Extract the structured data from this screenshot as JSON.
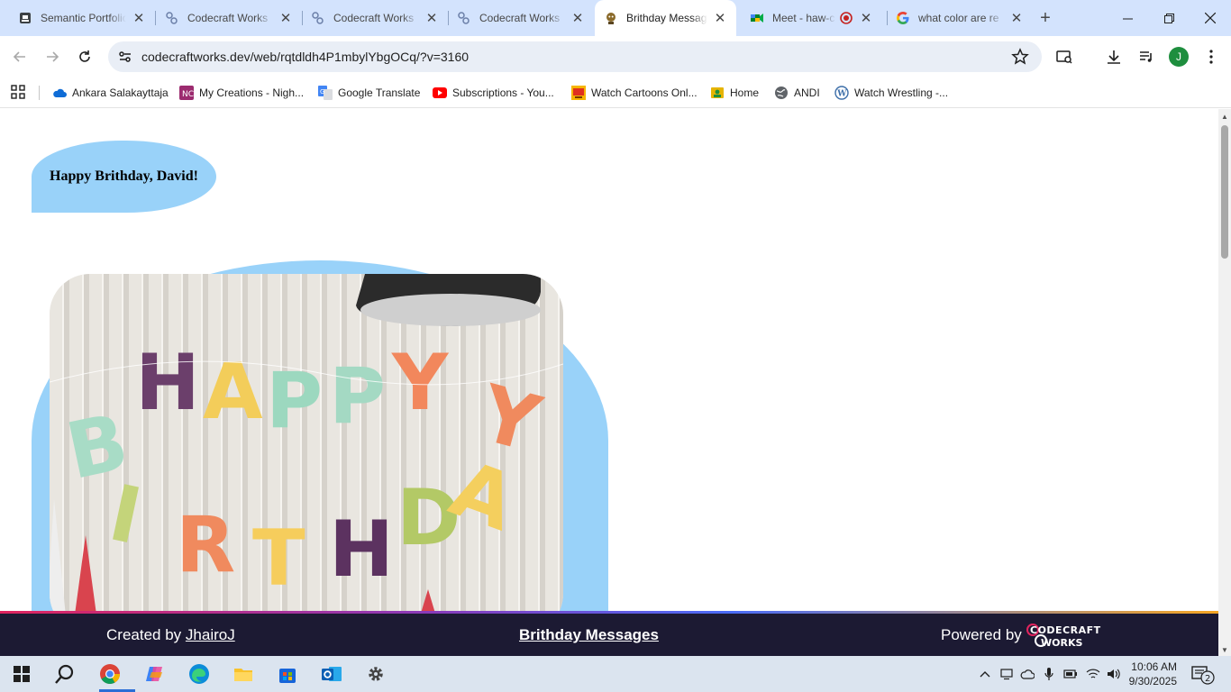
{
  "browser": {
    "tabs": [
      {
        "title": "Semantic Portfolio",
        "icon": "portfolio-icon",
        "active": false
      },
      {
        "title": "Codecraft Works",
        "icon": "codecraft-icon",
        "active": false
      },
      {
        "title": "Codecraft Works",
        "icon": "codecraft-icon",
        "active": false
      },
      {
        "title": "Codecraft Works",
        "icon": "codecraft-icon",
        "active": false
      },
      {
        "title": "Brithday Messages",
        "icon": "birthday-icon",
        "active": true
      },
      {
        "title": "Meet - haw-c",
        "icon": "meet-icon",
        "active": false
      },
      {
        "title": "what color are re",
        "icon": "google-icon",
        "active": false
      }
    ],
    "url": "codecraftworks.dev/web/rqtdldh4P1mbylYbgOCq/?v=3160",
    "profile_initial": "J",
    "bookmarks": [
      {
        "label": "Ankara Salakayttaja",
        "icon": "onedrive-icon"
      },
      {
        "label": "My Creations - Nigh...",
        "icon": "creations-icon"
      },
      {
        "label": "Google Translate",
        "icon": "translate-icon"
      },
      {
        "label": "Subscriptions - You...",
        "icon": "youtube-icon"
      },
      {
        "label": "Watch Cartoons Onl...",
        "icon": "cartoons-icon"
      },
      {
        "label": "Home",
        "icon": "home-icon"
      },
      {
        "label": "ANDI",
        "icon": "globe-icon"
      },
      {
        "label": "Watch Wrestling -...",
        "icon": "wordpress-icon"
      }
    ]
  },
  "page": {
    "greeting": "Happy Brithday, David!",
    "image_alt_letters": "HAPPY BIRTHDAY"
  },
  "footer": {
    "created_prefix": "Created by",
    "author": "JhairoJ",
    "title": "Brithday Messages",
    "powered_by": "Powered by",
    "logo_text_top": "CODECRAFT",
    "logo_text_bottom": "WORKS"
  },
  "taskbar": {
    "time": "10:06 AM",
    "date": "9/30/2025",
    "notification_count": "2"
  },
  "colors": {
    "accent_blue": "#99d2f9",
    "footer_bg": "#1c1a33",
    "tab_strip": "#d3e3fd"
  }
}
